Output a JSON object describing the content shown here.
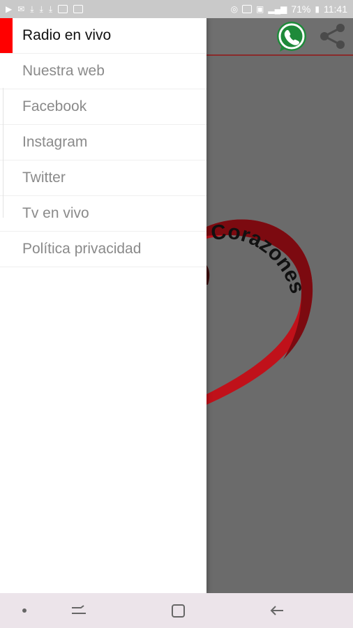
{
  "status_bar": {
    "battery": "71%",
    "time": "11:41"
  },
  "drawer": {
    "items": [
      {
        "label": "Radio en vivo",
        "active": true
      },
      {
        "label": "Nuestra web",
        "active": false
      },
      {
        "label": "Facebook",
        "active": false
      },
      {
        "label": "Instagram",
        "active": false
      },
      {
        "label": "Twitter",
        "active": false
      },
      {
        "label": "Tv en vivo",
        "active": false
      },
      {
        "label": "Política privacidad",
        "active": false
      }
    ]
  },
  "app": {
    "logo_text": "Corazones"
  },
  "icons": {
    "whatsapp": "whatsapp-icon",
    "share": "share-icon"
  },
  "colors": {
    "accent": "#ff0000",
    "whatsapp_green": "#25a244",
    "logo_red": "#c0111a"
  }
}
